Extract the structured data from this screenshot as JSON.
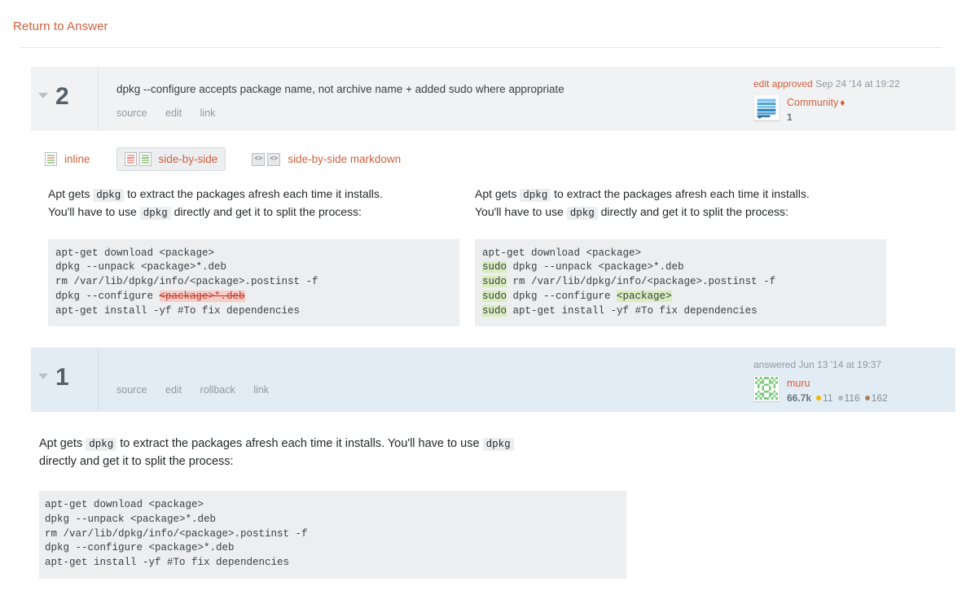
{
  "return_link": "Return to Answer",
  "revisions": [
    {
      "number": "2",
      "comment": "dpkg --configure accepts package name, not archive name + added sudo where appropriate",
      "actions": [
        "source",
        "edit",
        "link"
      ],
      "user_card": {
        "action_label": "edit approved",
        "timestamp": "Sep 24 '14 at 19:22",
        "avatar": "community-bot-avatar",
        "name": "Community",
        "diamond": "♦",
        "rep": "1",
        "badges": []
      }
    },
    {
      "number": "1",
      "comment": "",
      "actions": [
        "source",
        "edit",
        "rollback",
        "link"
      ],
      "user_card": {
        "action_label": "answered",
        "timestamp": "Jun 13 '14 at 19:37",
        "avatar": "muru-identicon-avatar",
        "name": "muru",
        "diamond": "",
        "rep": "66.7k",
        "badges": [
          {
            "tier": "gold",
            "count": "11"
          },
          {
            "tier": "silver",
            "count": "116"
          },
          {
            "tier": "bronze",
            "count": "162"
          }
        ]
      }
    }
  ],
  "view_tabs": [
    {
      "id": "inline",
      "label": "inline",
      "active": false
    },
    {
      "id": "side-by-side",
      "label": "side-by-side",
      "active": true
    },
    {
      "id": "side-by-side-markdown",
      "label": "side-by-side markdown",
      "active": false
    }
  ],
  "diff": {
    "left": {
      "para_line1_a": "Apt gets ",
      "para_code1": "dpkg",
      "para_line1_b": " to extract the packages afresh each time it installs.",
      "para_line2_a": "You'll have to use ",
      "para_code2": "dpkg",
      "para_line2_b": " directly and get it to split the process:",
      "code_lines": [
        {
          "plain": "apt-get download <package>"
        },
        {
          "plain": "dpkg --unpack <package>*.deb"
        },
        {
          "plain": "rm /var/lib/dpkg/info/<package>.postinst -f"
        },
        {
          "pre": "dpkg --configure ",
          "del": "<package>*.deb",
          "post": ""
        },
        {
          "plain": "apt-get install -yf #To fix dependencies"
        }
      ]
    },
    "right": {
      "para_line1_a": "Apt gets ",
      "para_code1": "dpkg",
      "para_line1_b": " to extract the packages afresh each time it installs.",
      "para_line2_a": "You'll have to use ",
      "para_code2": "dpkg",
      "para_line2_b": " directly and get it to split the process:",
      "code_lines": [
        {
          "plain": "apt-get download <package>"
        },
        {
          "add": "sudo",
          "post": " dpkg --unpack <package>*.deb"
        },
        {
          "add": "sudo",
          "post": " rm /var/lib/dpkg/info/<package>.postinst -f"
        },
        {
          "add": "sudo",
          "post": " dpkg --configure ",
          "add2": "<package>"
        },
        {
          "add": "sudo",
          "post": " apt-get install -yf #To fix dependencies"
        }
      ]
    }
  },
  "answer": {
    "para_a": "Apt gets ",
    "code1": "dpkg",
    "para_b": " to extract the packages afresh each time it installs. You'll have to use ",
    "code2": "dpkg",
    "para_c": "directly and get it to split the process:",
    "code_block": "apt-get download <package>\ndpkg --unpack <package>*.deb\nrm /var/lib/dpkg/info/<package>.postinst -f\ndpkg --configure <package>*.deb\napt-get install -yf #To fix dependencies"
  },
  "colors": {
    "accent": "#d1603d",
    "header_grey": "#f1f2f3",
    "header_blue": "#e1ecf4",
    "code_bg": "#eceeef",
    "add_hl": "#d8ecbe",
    "del_hl": "#f7cdc8",
    "gold": "#f1b600",
    "silver": "#b4b8bc",
    "bronze": "#ab825f"
  }
}
